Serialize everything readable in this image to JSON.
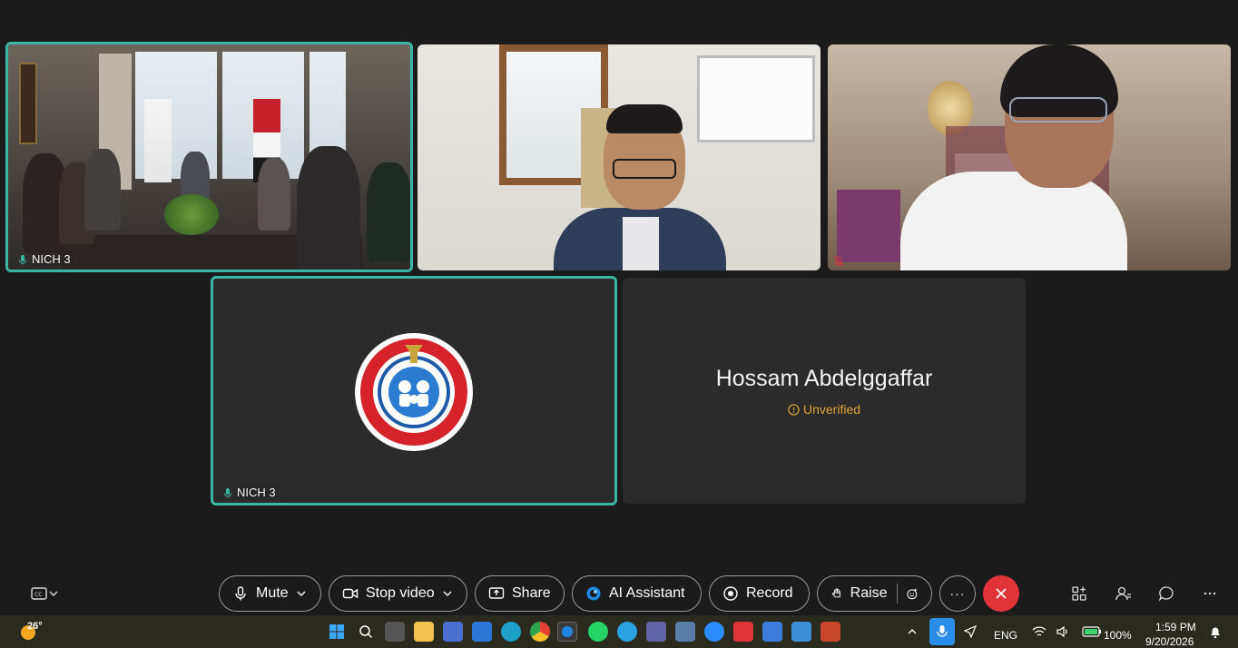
{
  "tiles": [
    {
      "label": "NICH 3"
    },
    {
      "label": ""
    },
    {
      "label": ""
    },
    {
      "label": "NICH 3"
    },
    {
      "name": "Hossam Abdelggaffar",
      "status": "Unverified"
    }
  ],
  "toolbar": {
    "mute_label": "Mute",
    "stop_video_label": "Stop video",
    "share_label": "Share",
    "ai_label": "AI Assistant",
    "record_label": "Record",
    "raise_label": "Raise",
    "more_label": "···"
  },
  "taskbar": {
    "weather_temp": "26°",
    "language": "ENG",
    "battery": "100%",
    "time": "1:59 PM",
    "date": "9/20/2026"
  },
  "colors": {
    "active_border": "#3bb6a4",
    "end_call": "#e0333a",
    "unverified": "#e3a43c"
  }
}
